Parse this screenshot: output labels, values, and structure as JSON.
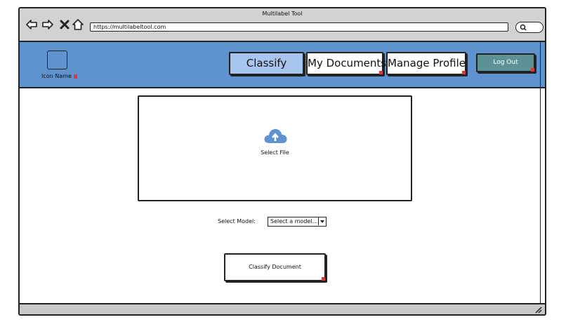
{
  "browser": {
    "title": "Multilabel Tool",
    "url": "https://multilabeltool.com",
    "icons": [
      "back-arrow-icon",
      "forward-arrow-icon",
      "close-icon",
      "home-icon",
      "search-icon"
    ]
  },
  "header": {
    "logo_label": "Icon Name",
    "nav": [
      {
        "label": "Classify",
        "active": true
      },
      {
        "label": "My Documents",
        "active": false
      },
      {
        "label": "Manage Profile",
        "active": false
      }
    ],
    "logout_label": "Log Out"
  },
  "upload": {
    "icon": "cloud-upload-icon",
    "label": "Select File"
  },
  "model": {
    "label": "Select Model:",
    "selected": "Select a model..."
  },
  "action": {
    "classify_label": "Classify Document"
  },
  "colors": {
    "header_bg": "#5f93cf",
    "active_tab": "#a8c6ee",
    "logout_bg": "#5c9296",
    "titlebar": "#d2d2d2",
    "marker": "#d43b3b"
  }
}
